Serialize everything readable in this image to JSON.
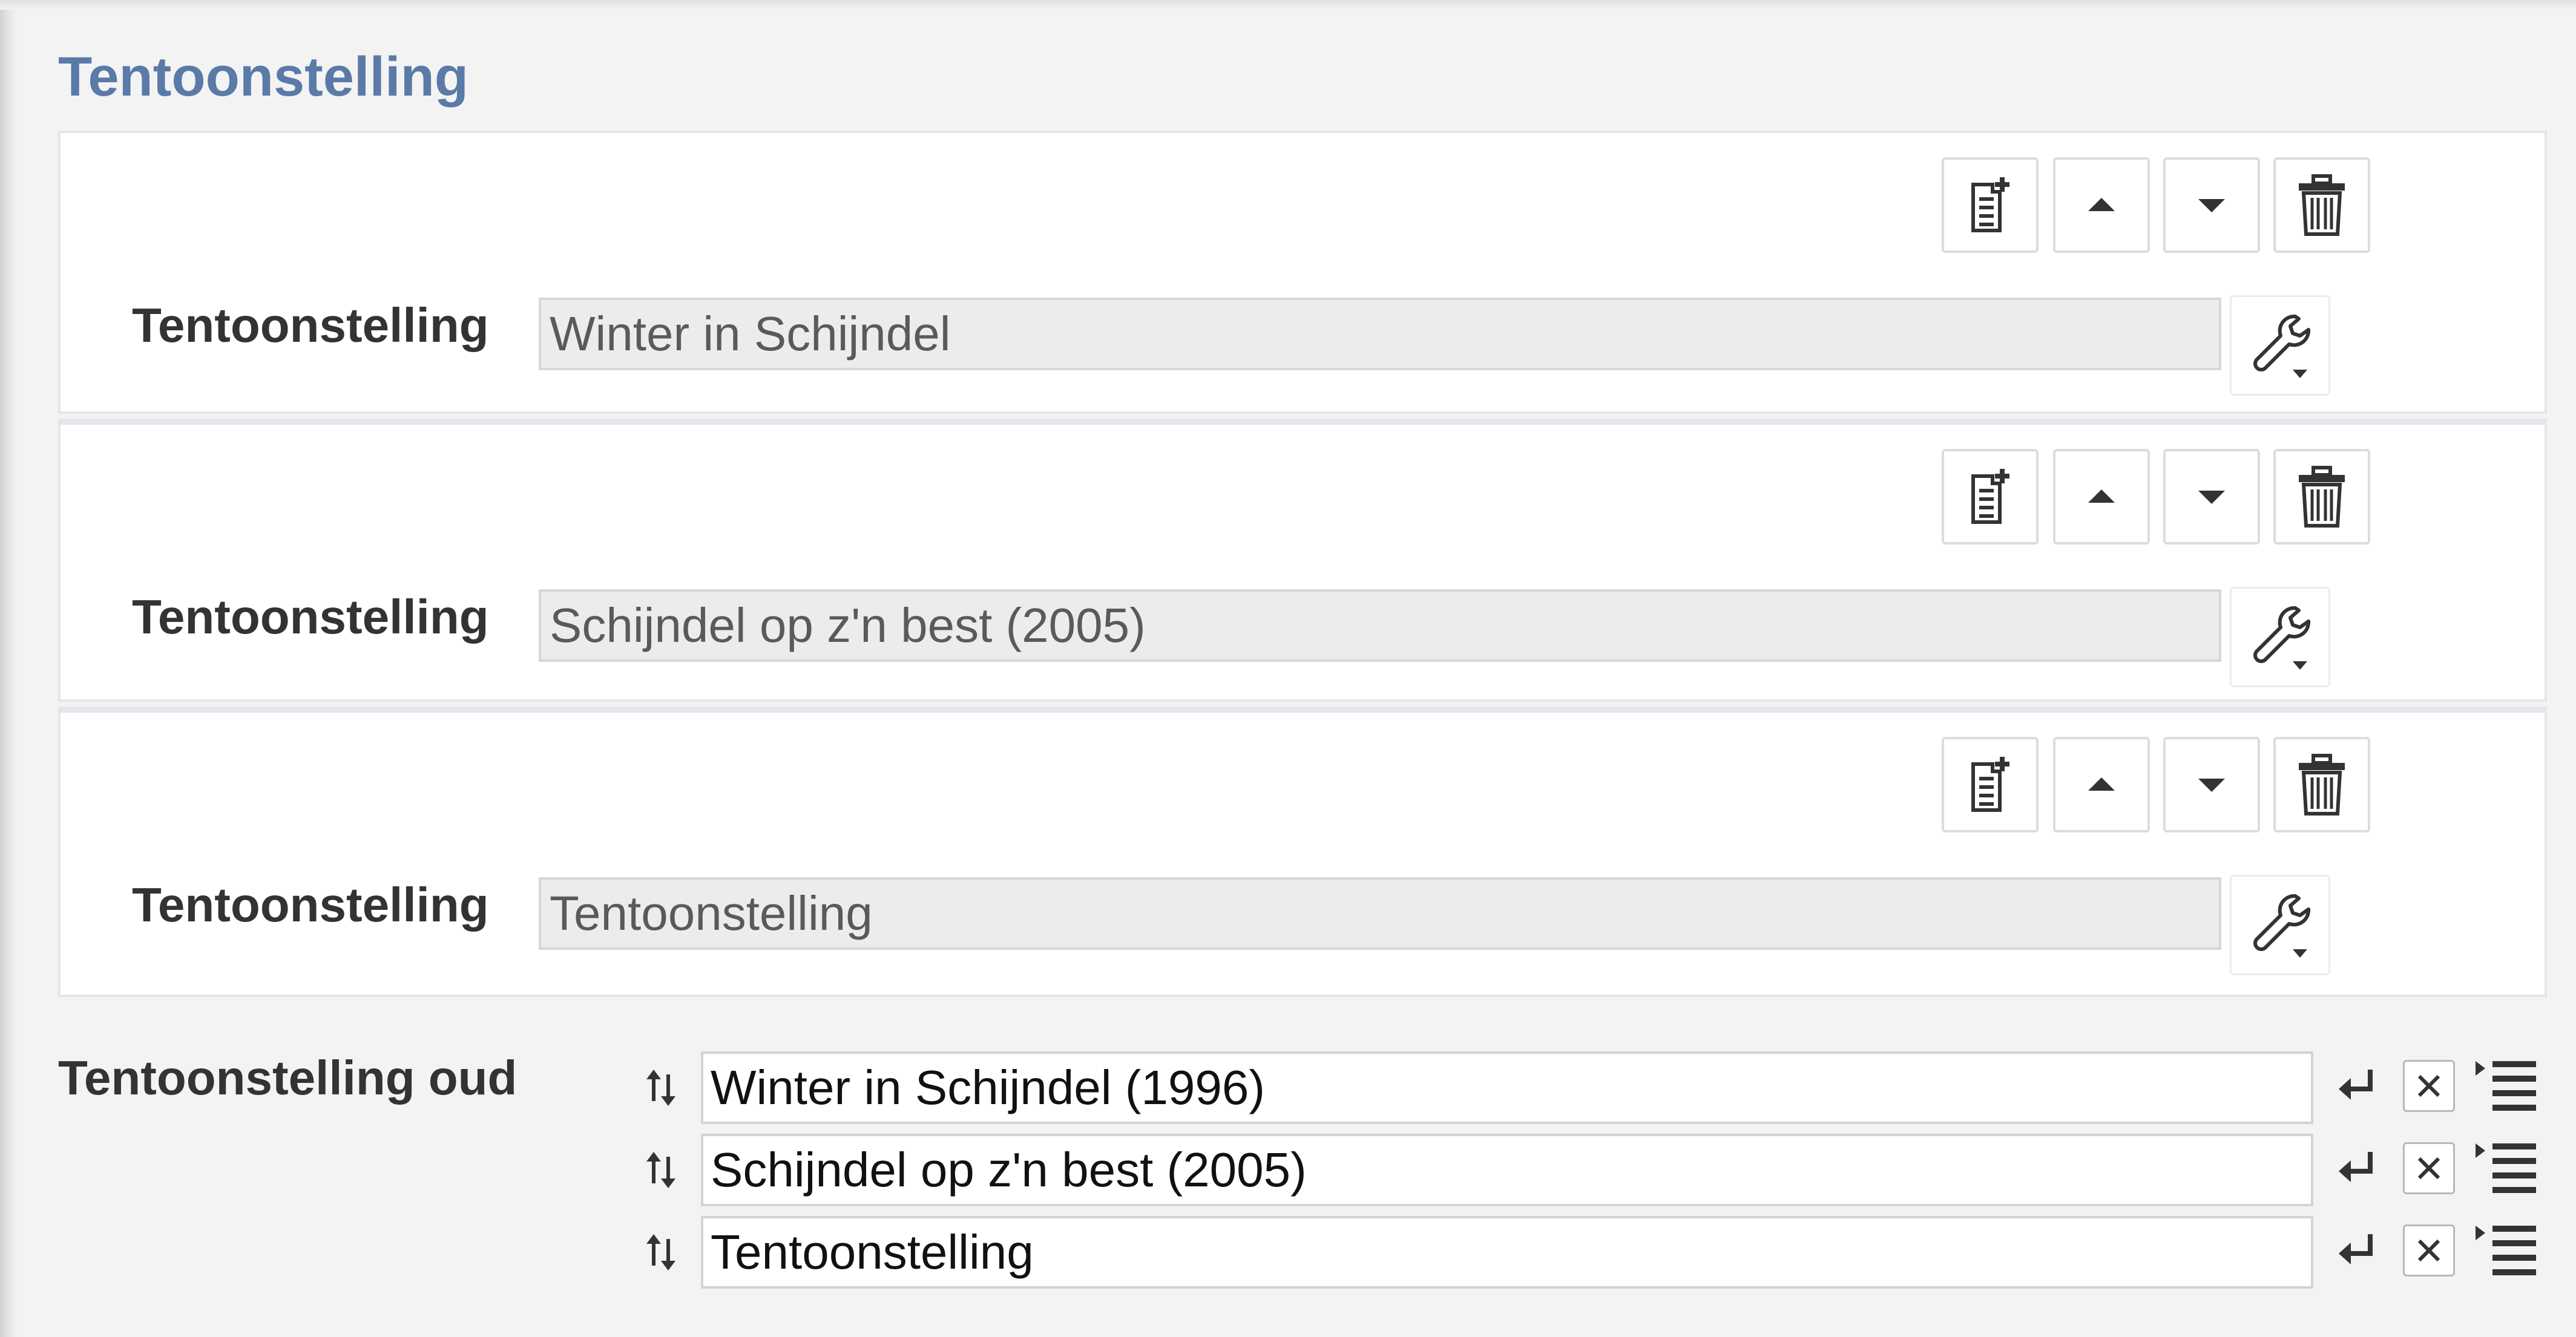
{
  "section": {
    "title": "Tentoonstelling"
  },
  "toolbar_icons": [
    "add-document-icon",
    "move-up-icon",
    "move-down-icon",
    "trash-icon"
  ],
  "groups": [
    {
      "label": "Tentoonstelling",
      "value": "Winter in Schijndel"
    },
    {
      "label": "Tentoonstelling",
      "value": "Schijndel op z'n best (2005)"
    },
    {
      "label": "Tentoonstelling",
      "value": "Tentoonstelling"
    }
  ],
  "old_field": {
    "label": "Tentoonstelling oud",
    "values": [
      "Winter in Schijndel (1996)",
      "Schijndel op z'n best (2005)",
      "Tentoonstelling"
    ]
  },
  "colors": {
    "title": "#5a7aa8",
    "input_readonly_bg": "#ececec",
    "icon": "#333333"
  }
}
